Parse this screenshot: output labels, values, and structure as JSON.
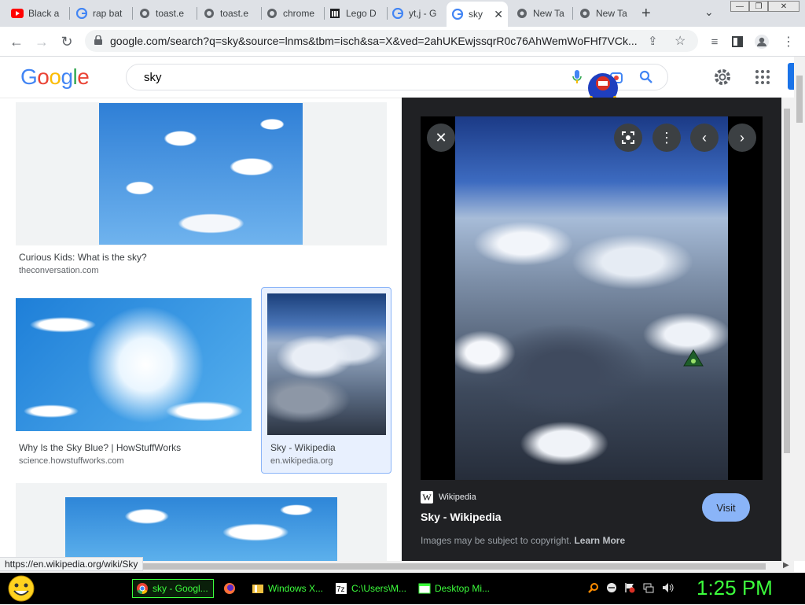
{
  "browser": {
    "tabs": [
      {
        "label": "Black a",
        "icon": "youtube-icon"
      },
      {
        "label": "rap bat",
        "icon": "google-icon"
      },
      {
        "label": "toast.e",
        "icon": "globe-icon"
      },
      {
        "label": "toast.e",
        "icon": "globe-icon"
      },
      {
        "label": "chrome",
        "icon": "globe-icon"
      },
      {
        "label": "Lego D",
        "icon": "museum-icon"
      },
      {
        "label": "yt,j - G",
        "icon": "google-icon"
      },
      {
        "label": "sky",
        "icon": "google-icon",
        "active": true
      },
      {
        "label": "New Ta",
        "icon": "chrome-icon"
      },
      {
        "label": "New Ta",
        "icon": "chrome-icon"
      }
    ],
    "url": "google.com/search?q=sky&source=lnms&tbm=isch&sa=X&ved=2ahUKEwjssqrR0c76AhWemWoFHf7VCk...",
    "status_url": "https://en.wikipedia.org/wiki/Sky"
  },
  "google": {
    "logo": "Google",
    "query": "sky"
  },
  "results": [
    {
      "caption": "Curious Kids: What is the sky?",
      "source": "theconversation.com"
    },
    {
      "caption": "Why Is the Sky Blue? | HowStuffWorks",
      "source": "science.howstuffworks.com"
    },
    {
      "caption": "Sky - Wikipedia",
      "source": "en.wikipedia.org",
      "selected": true
    }
  ],
  "preview": {
    "site": "Wikipedia",
    "site_letter": "W",
    "title": "Sky - Wikipedia",
    "visit": "Visit",
    "copyright": "Images may be subject to copyright.",
    "learn_more": "Learn More"
  },
  "taskbar": {
    "tasks": [
      {
        "label": "sky - Googl...",
        "icon": "chrome-icon"
      },
      {
        "label": "",
        "icon": "firefox-icon"
      },
      {
        "label": "Windows X...",
        "icon": "folder-icon"
      },
      {
        "label": "C:\\Users\\M...",
        "icon": "7zip-icon"
      },
      {
        "label": "Desktop Mi...",
        "icon": "window-icon"
      }
    ],
    "clock": "1:25 PM"
  },
  "colors": {
    "google_blue": "#4285f4",
    "google_red": "#ea4335",
    "google_yellow": "#fbbc05",
    "google_green": "#34a853",
    "taskbar_text": "#3cff3c",
    "visit_button": "#8ab4f8"
  }
}
